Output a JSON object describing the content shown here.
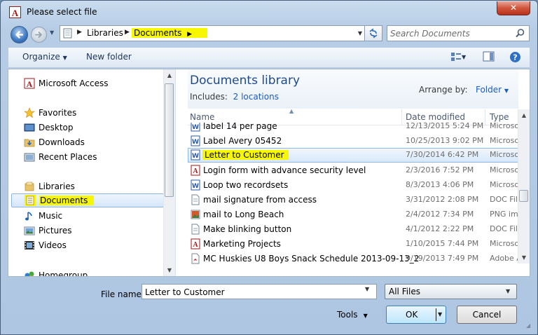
{
  "window": {
    "title": "Please select file",
    "close_label": "✕"
  },
  "address": {
    "crumbs": [
      "Libraries",
      "Documents"
    ],
    "search_placeholder": "Search Documents"
  },
  "toolbar": {
    "organize": "Organize",
    "new_folder": "New folder"
  },
  "nav": {
    "items": [
      {
        "label": "Microsoft Access",
        "icon": "access-icon"
      },
      {
        "label": "Favorites",
        "icon": "star-icon"
      },
      {
        "label": "Desktop",
        "icon": "desktop-icon"
      },
      {
        "label": "Downloads",
        "icon": "downloads-folder-icon"
      },
      {
        "label": "Recent Places",
        "icon": "recent-places-icon"
      },
      {
        "label": "Libraries",
        "icon": "libraries-icon"
      },
      {
        "label": "Documents",
        "icon": "documents-library-icon"
      },
      {
        "label": "Music",
        "icon": "music-icon"
      },
      {
        "label": "Pictures",
        "icon": "pictures-icon"
      },
      {
        "label": "Videos",
        "icon": "videos-icon"
      },
      {
        "label": "Homegroup",
        "icon": "homegroup-icon"
      }
    ]
  },
  "library": {
    "title": "Documents library",
    "includes_label": "Includes:",
    "includes_link": "2 locations",
    "arrange_label": "Arrange by:",
    "arrange_value": "Folder"
  },
  "columns": {
    "name": "Name",
    "date": "Date modified",
    "type": "Type"
  },
  "files": [
    {
      "name": "label 14 per page",
      "date": "12/13/2015 5:24 PM",
      "type": "Microso",
      "icon": "word-doc-icon"
    },
    {
      "name": "Label Avery 05452",
      "date": "10/25/2013 9:02 PM",
      "type": "Microso",
      "icon": "word-doc-icon"
    },
    {
      "name": "Letter to Customer",
      "date": "7/30/2014 6:42 PM",
      "type": "Microso",
      "icon": "word-doc-icon"
    },
    {
      "name": "Login form with advance security level",
      "date": "2/3/2016 7:52 PM",
      "type": "Microso",
      "icon": "access-file-icon"
    },
    {
      "name": "Loop two recordsets",
      "date": "8/3/2013 4:06 PM",
      "type": "Microso",
      "icon": "word-doc-icon"
    },
    {
      "name": "mail signature from access",
      "date": "3/31/2012 2:08 PM",
      "type": "DOC File",
      "icon": "doc-file-icon"
    },
    {
      "name": "mail to Long Beach",
      "date": "2/4/2012 7:34 PM",
      "type": "PNG im",
      "icon": "png-image-icon"
    },
    {
      "name": "Make blinking button",
      "date": "4/1/2012 2:22 PM",
      "type": "DOC File",
      "icon": "doc-file-icon"
    },
    {
      "name": "Marketing Projects",
      "date": "1/10/2015 7:44 PM",
      "type": "Microso",
      "icon": "access-file-icon"
    },
    {
      "name": "MC Huskies U8 Boys Snack Schedule 2013-09-13_2",
      "date": "9/19/2013 7:49 PM",
      "type": "Adobe A",
      "icon": "pdf-file-icon"
    }
  ],
  "bottom": {
    "file_name_label": "File name:",
    "file_name_value": "Letter to Customer",
    "file_type": "All Files",
    "tools": "Tools",
    "ok": "OK",
    "cancel": "Cancel"
  }
}
